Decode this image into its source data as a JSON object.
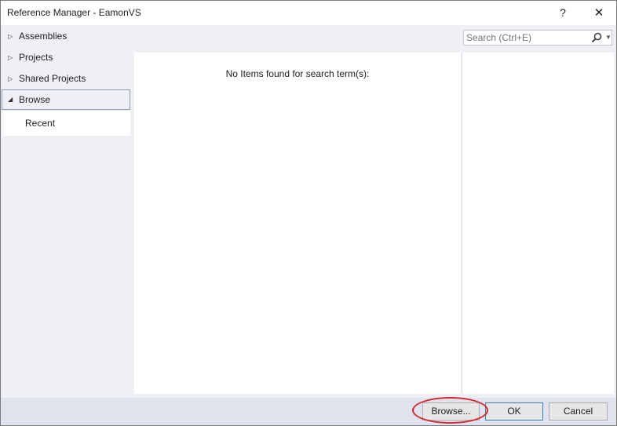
{
  "window": {
    "title": "Reference Manager - EamonVS",
    "help_label": "?",
    "close_label": "✕"
  },
  "sidebar": {
    "items": [
      {
        "label": "Assemblies",
        "expanded": false
      },
      {
        "label": "Projects",
        "expanded": false
      },
      {
        "label": "Shared Projects",
        "expanded": false
      },
      {
        "label": "Browse",
        "expanded": true,
        "selected": true
      }
    ],
    "subitems": [
      {
        "label": "Recent"
      }
    ]
  },
  "search": {
    "placeholder": "Search (Ctrl+E)",
    "value": "",
    "icon": "search-icon"
  },
  "main": {
    "empty_message": "No Items found for search term(s):"
  },
  "footer": {
    "browse_label": "Browse...",
    "ok_label": "OK",
    "cancel_label": "Cancel"
  },
  "annotation": {
    "highlight_color": "#d7262e"
  }
}
